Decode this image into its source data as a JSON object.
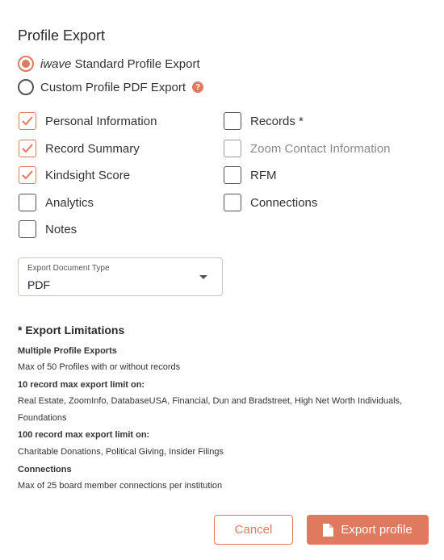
{
  "title": "Profile Export",
  "export_options": [
    {
      "prefix": "iwave",
      "label": " Standard Profile Export",
      "selected": true
    },
    {
      "prefix": "",
      "label": "Custom Profile PDF Export",
      "selected": false,
      "help": "?"
    }
  ],
  "checkboxes_left": [
    {
      "label": "Personal Information",
      "checked": true
    },
    {
      "label": "Record Summary",
      "checked": true
    },
    {
      "label": "Kindsight Score",
      "checked": true
    },
    {
      "label": "Analytics",
      "checked": false
    },
    {
      "label": "Notes",
      "checked": false
    }
  ],
  "checkboxes_right": [
    {
      "label": "Records *",
      "checked": false
    },
    {
      "label": "Zoom Contact Information",
      "checked": false,
      "disabled": true
    },
    {
      "label": "RFM",
      "checked": false
    },
    {
      "label": "Connections",
      "checked": false
    }
  ],
  "document_type": {
    "caption": "Export Document Type",
    "value": "PDF"
  },
  "limitations": {
    "heading": "* Export Limitations",
    "lines": [
      {
        "text": "Multiple Profile Exports",
        "bold": true
      },
      {
        "text": "Max of 50 Profiles with or without records",
        "bold": false
      },
      {
        "text": "10 record max export limit on:",
        "bold": true
      },
      {
        "text": "Real Estate, ZoomInfo, DatabaseUSA, Financial, Dun and Bradstreet, High Net Worth Individuals, Foundations",
        "bold": false
      },
      {
        "text": "100 record max export limit on:",
        "bold": true
      },
      {
        "text": "Charitable Donations, Political Giving, Insider Filings",
        "bold": false
      },
      {
        "text": "Connections",
        "bold": true
      },
      {
        "text": "Max of 25 board member connections per institution",
        "bold": false
      }
    ]
  },
  "buttons": {
    "cancel": "Cancel",
    "export": "Export profile"
  },
  "colors": {
    "accent": "#e07a5f"
  }
}
